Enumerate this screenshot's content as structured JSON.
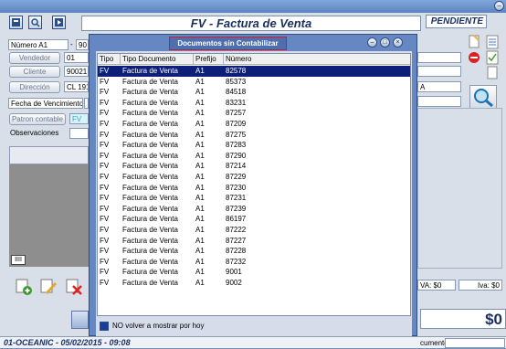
{
  "main": {
    "title": "FV - Factura de Venta",
    "status": "PENDIENTE",
    "fields": {
      "number_label": "Número A1",
      "number_value": "-",
      "number_suffix": "90",
      "vendor_button": "Vendedor",
      "vendor_value": "01",
      "client_button": "Cliente",
      "client_value": "90021",
      "address_button": "Dirección",
      "address_value": "CL 191",
      "due_date_label": "Fecha de Vencimiento",
      "account_pattern_button": "Patron contable",
      "account_pattern_value": "FV",
      "notes_label": "Observaciones",
      "side_value_a": "A"
    },
    "grid_badge": "IIII",
    "totals": {
      "iva_left": "VA: $0",
      "iva_right": "Iva: $0",
      "total": "$0",
      "document_label": "cumento"
    },
    "status_bar": "01-OCEANIC - 05/02/2015 - 09:08"
  },
  "dialog": {
    "title": "Documentos sin Contabilizar",
    "columns": [
      "Tipo",
      "Tipo Documento",
      "Prefijo",
      "Número"
    ],
    "rows": [
      [
        "FV",
        "Factura de Venta",
        "A1",
        "82578"
      ],
      [
        "FV",
        "Factura de Venta",
        "A1",
        "85373"
      ],
      [
        "FV",
        "Factura de Venta",
        "A1",
        "84518"
      ],
      [
        "FV",
        "Factura de Venta",
        "A1",
        "83231"
      ],
      [
        "FV",
        "Factura de Venta",
        "A1",
        "87257"
      ],
      [
        "FV",
        "Factura de Venta",
        "A1",
        "87209"
      ],
      [
        "FV",
        "Factura de Venta",
        "A1",
        "87275"
      ],
      [
        "FV",
        "Factura de Venta",
        "A1",
        "87283"
      ],
      [
        "FV",
        "Factura de Venta",
        "A1",
        "87290"
      ],
      [
        "FV",
        "Factura de Venta",
        "A1",
        "87214"
      ],
      [
        "FV",
        "Factura de Venta",
        "A1",
        "87229"
      ],
      [
        "FV",
        "Factura de Venta",
        "A1",
        "87230"
      ],
      [
        "FV",
        "Factura de Venta",
        "A1",
        "87231"
      ],
      [
        "FV",
        "Factura de Venta",
        "A1",
        "87239"
      ],
      [
        "FV",
        "Factura de Venta",
        "A1",
        "86197"
      ],
      [
        "FV",
        "Factura de Venta",
        "A1",
        "87222"
      ],
      [
        "FV",
        "Factura de Venta",
        "A1",
        "87227"
      ],
      [
        "FV",
        "Factura de Venta",
        "A1",
        "87228"
      ],
      [
        "FV",
        "Factura de Venta",
        "A1",
        "87232"
      ],
      [
        "FV",
        "Factura de Venta",
        "A1",
        "9001"
      ],
      [
        "FV",
        "Factura de Venta",
        "A1",
        "9002"
      ]
    ],
    "selected_row": 0,
    "checkbox_label": "NO volver a mostrar por hoy",
    "checkbox_checked": true
  },
  "colors": {
    "selection": "#0e1f7a",
    "title_border": "#d21a1a",
    "accent": "#1b2f63"
  }
}
